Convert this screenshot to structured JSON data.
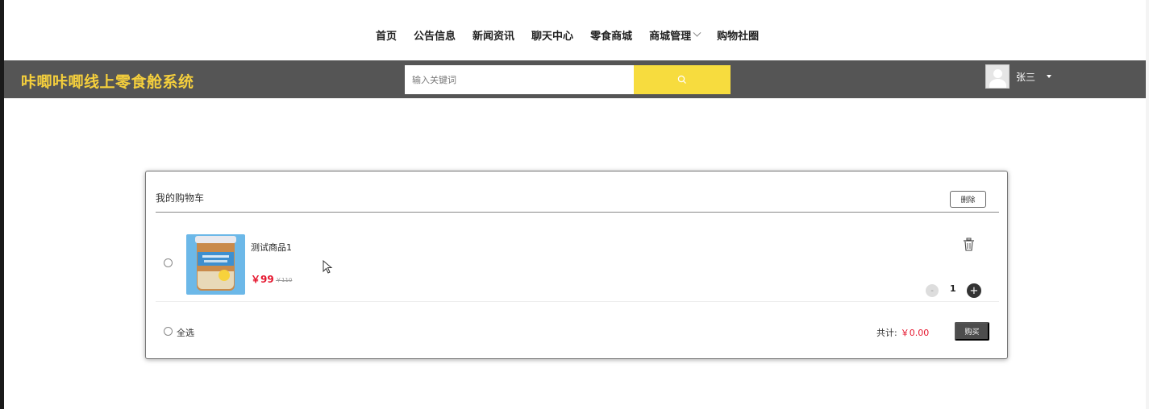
{
  "topnav": {
    "items": [
      "首页",
      "公告信息",
      "新闻资讯",
      "聊天中心",
      "零食商城",
      "商城管理",
      "购物社圈"
    ]
  },
  "header": {
    "brand": "咔唧咔唧线上零食舱系统",
    "search_placeholder": "输入关键词",
    "search_icon": "search-icon",
    "username": "张三",
    "colors": {
      "bar": "#555555",
      "brand": "#f5cf3c",
      "search_button": "#f7dc3e"
    }
  },
  "cart": {
    "title": "我的购物车",
    "delete_label": "删除",
    "items": [
      {
        "name": "测试商品1",
        "price": "￥99",
        "original_price": "￥110",
        "quantity": "1",
        "minus": "-",
        "plus": "+"
      }
    ],
    "select_all_label": "全选",
    "total_label": "共计:",
    "total_value": "￥0.00",
    "buy_label": "购买",
    "accent_color": "#e5162e"
  }
}
